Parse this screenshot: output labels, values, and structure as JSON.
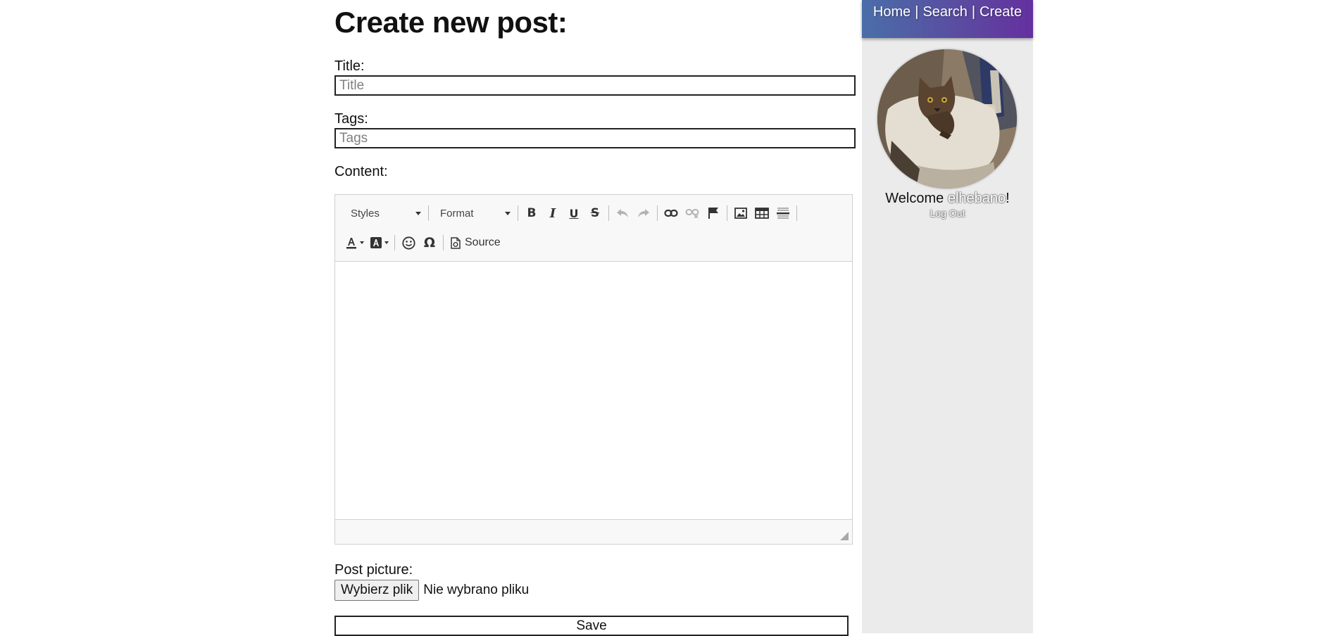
{
  "page": {
    "title": "Create new post:"
  },
  "form": {
    "title_label": "Title:",
    "title_placeholder": "Title",
    "tags_label": "Tags:",
    "tags_placeholder": "Tags",
    "content_label": "Content:",
    "picture_label": "Post picture:",
    "file_button": "Wybierz plik",
    "file_status": "Nie wybrano pliku",
    "save_label": "Save"
  },
  "editor": {
    "styles_combo": "Styles",
    "format_combo": "Format",
    "source_label": "Source",
    "icons": [
      "bold-icon",
      "italic-icon",
      "underline-icon",
      "strikethrough-icon",
      "undo-icon",
      "redo-icon",
      "link-icon",
      "unlink-icon",
      "anchor-flag-icon",
      "image-icon",
      "table-icon",
      "horizontal-line-icon",
      "text-color-icon",
      "background-color-icon",
      "smiley-icon",
      "omega-icon",
      "source-icon"
    ]
  },
  "nav": {
    "home": "Home",
    "search": "Search",
    "create": "Create",
    "separator": "|"
  },
  "user": {
    "welcome_prefix": "Welcome ",
    "username": "elhebano",
    "welcome_suffix": "!",
    "logout": "Log Out"
  },
  "colors": {
    "nav_gradient_start": "#4a6ea9",
    "nav_gradient_end": "#6530a0",
    "sidebar_bg": "#ebebeb"
  }
}
